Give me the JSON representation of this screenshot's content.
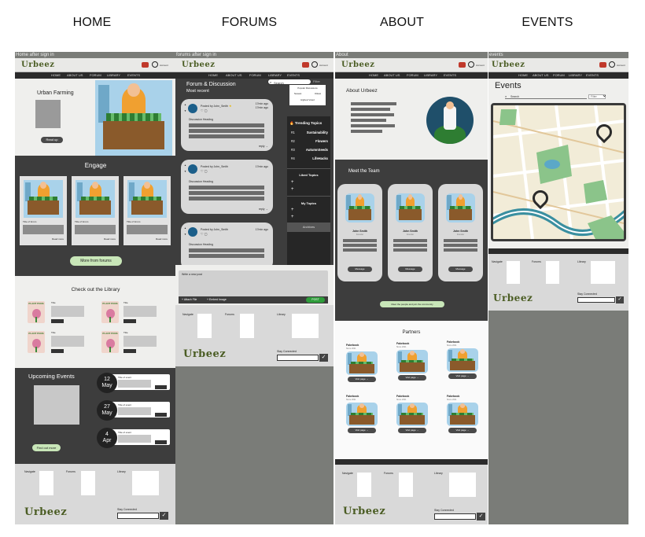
{
  "headers": [
    "HOME",
    "FORUMS",
    "ABOUT",
    "EVENTS"
  ],
  "frames": {
    "home": {
      "title": "Home after sign in",
      "logo": "Urbeez"
    },
    "forums": {
      "title": "forums after sign in",
      "logo": "Urbeez"
    },
    "about": {
      "title": "About",
      "logo": "Urbeez"
    },
    "events": {
      "title": "events",
      "logo": "Urbeez"
    }
  },
  "nav": [
    "HOME",
    "ABOUT US",
    "FORUM",
    "LIBRARY",
    "EVENTS"
  ],
  "account_label": "Account",
  "home": {
    "hero_title": "Urban Farming",
    "hero_button": "Read up",
    "engage_title": "Engage",
    "engage_cards": [
      {
        "title": "Title of forum",
        "link": "Read more"
      },
      {
        "title": "Title of forum",
        "link": "Read more"
      },
      {
        "title": "Title of forum",
        "link": "Read more"
      }
    ],
    "more_forums": "More from forums",
    "library_title": "Check out the Library",
    "library_book_title": "PLANT PONS",
    "library_items": [
      "Title",
      "Title",
      "Title",
      "Title"
    ],
    "events_title": "Upcoming Events",
    "events": [
      {
        "day": "12",
        "month": "May",
        "title": "Title of event"
      },
      {
        "day": "27",
        "month": "May",
        "title": "Title of event"
      },
      {
        "day": "4",
        "month": "Apr",
        "title": "Title of event"
      }
    ],
    "find_out_more": "Find out more"
  },
  "footer": {
    "navigate": "Navigate",
    "forums": "Forums",
    "library": "Library",
    "stay": "Stay Connected",
    "check": "✓"
  },
  "forums": {
    "heading": "Forum & Discussion",
    "subheading": "Most recent",
    "search_placeholder": "Search",
    "filter_label": "Filter",
    "filter_options": [
      "Popular Discussions",
      "Newest",
      "Oldest",
      "Highest Voted"
    ],
    "posts": [
      {
        "posted": "Posted by John_Smith",
        "time1": "17min ago",
        "time2": "17min ago",
        "heading": "Discussion Heading",
        "reply": "reply →"
      },
      {
        "posted": "Posted by John_Smith",
        "time1": "17min ago",
        "heading": "Discussion Heading",
        "reply": "reply →"
      },
      {
        "posted": "Posted by John_Smith",
        "time1": "17min ago",
        "heading": "Discussion Heading"
      }
    ],
    "trending_title": "Trending Topics",
    "trending": [
      {
        "rank": "#1",
        "topic": "Sustainability"
      },
      {
        "rank": "#2",
        "topic": "Flowers"
      },
      {
        "rank": "#3",
        "topic": "AutumnSeeds"
      },
      {
        "rank": "#4",
        "topic": "LifeHacks"
      }
    ],
    "liked_title": "Liked Topics",
    "my_topics_title": "My Topics",
    "plus": "+",
    "archives": "Archives",
    "write_post": "Write a new post",
    "attach": "+ Attach File",
    "embed": "+ Embed Image",
    "post_button": "POST"
  },
  "about": {
    "title": "About Urbeez",
    "team_title": "Meet the Team",
    "team": [
      {
        "name": "John Smith",
        "role": "Founder",
        "button": "Message"
      },
      {
        "name": "John Smith",
        "role": "Founder",
        "button": "Message"
      },
      {
        "name": "John Smith",
        "role": "Founder",
        "button": "Message"
      }
    ],
    "community_button": "Meet the people and join the community",
    "partners_title": "Partners",
    "partners": [
      {
        "name": "Fakebook",
        "since": "Since 2021",
        "button": "Visit page →"
      },
      {
        "name": "Fakebook",
        "since": "Since 2021",
        "button": "Visit page →"
      },
      {
        "name": "Fakebook",
        "since": "Since 2021",
        "button": "Visit page →"
      },
      {
        "name": "Fakebook",
        "since": "Since 2021",
        "button": "Visit page →"
      },
      {
        "name": "Fakebook",
        "since": "Since 2021",
        "button": "Visit page →"
      },
      {
        "name": "Fakebook",
        "since": "Since 2021",
        "button": "Visit page →"
      }
    ]
  },
  "events": {
    "title": "Events",
    "search_placeholder": "Search",
    "filter_label": "Filter",
    "filter_caret": "⌄"
  },
  "colors": {
    "brand": "#4b5d24",
    "dark": "#3d3d3d",
    "accent_green": "#c8e6b8",
    "post_green": "#2e9d3a"
  }
}
